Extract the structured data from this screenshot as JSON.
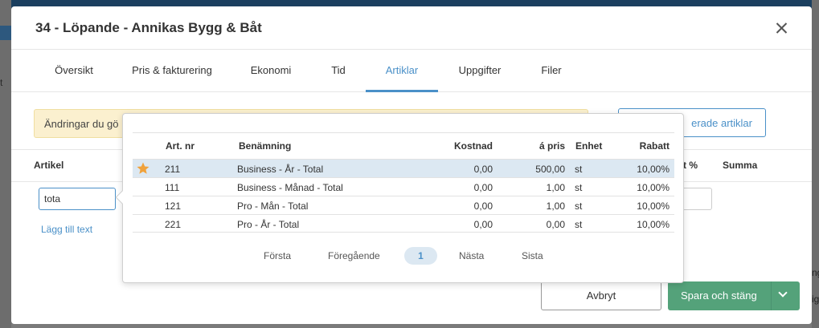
{
  "background": {
    "left_edge_char": "t",
    "right_edge_text_1": "ng",
    "right_edge_text_2": "ig"
  },
  "modal": {
    "title": "34 - Löpande - Annikas Bygg & Båt",
    "tabs": [
      {
        "label": "Översikt",
        "active": false
      },
      {
        "label": "Pris & fakturering",
        "active": false
      },
      {
        "label": "Ekonomi",
        "active": false
      },
      {
        "label": "Tid",
        "active": false
      },
      {
        "label": "Artiklar",
        "active": true
      },
      {
        "label": "Uppgifter",
        "active": false
      },
      {
        "label": "Filer",
        "active": false
      }
    ],
    "notice_text": "Ändringar du gö",
    "outline_button_label": "erade artiklar",
    "table_headers": {
      "artikel": "Artikel",
      "rabatt_pct": "t %",
      "summa": "Summa"
    },
    "artikel_input_value": "tota",
    "add_text_link": "Lägg till text",
    "cancel_label": "Avbryt",
    "save_label": "Spara och stäng"
  },
  "popup": {
    "headers": {
      "art_nr": "Art. nr",
      "benamning": "Benämning",
      "kostnad": "Kostnad",
      "a_pris": "á pris",
      "enhet": "Enhet",
      "rabatt": "Rabatt"
    },
    "rows": [
      {
        "art_nr": "211",
        "benamning": "Business - År - Total",
        "kostnad": "0,00",
        "a_pris": "500,00",
        "enhet": "st",
        "rabatt": "10,00%",
        "favorite": true
      },
      {
        "art_nr": "111",
        "benamning": "Business - Månad - Total",
        "kostnad": "0,00",
        "a_pris": "1,00",
        "enhet": "st",
        "rabatt": "10,00%",
        "favorite": false
      },
      {
        "art_nr": "121",
        "benamning": "Pro - Mån - Total",
        "kostnad": "0,00",
        "a_pris": "1,00",
        "enhet": "st",
        "rabatt": "10,00%",
        "favorite": false
      },
      {
        "art_nr": "221",
        "benamning": "Pro - År - Total",
        "kostnad": "0,00",
        "a_pris": "0,00",
        "enhet": "st",
        "rabatt": "10,00%",
        "favorite": false
      }
    ],
    "pagination": {
      "first": "Första",
      "prev": "Föregående",
      "page": "1",
      "next": "Nästa",
      "last": "Sista"
    }
  },
  "colors": {
    "accent": "#4a90c8",
    "save_button": "#54a27a",
    "selected_row": "#dce8f2",
    "notice_bg": "#fbf0cf",
    "star": "#f0a23c"
  },
  "icons": {
    "close": "close-icon",
    "favorite": "star-icon",
    "dropdown": "chevron-down-icon"
  }
}
